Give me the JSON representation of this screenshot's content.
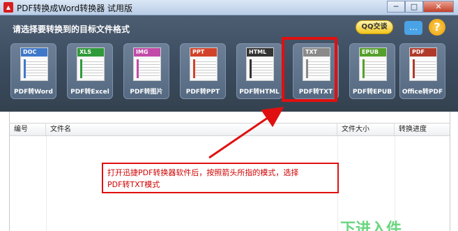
{
  "window": {
    "title": "PDF转换成Word转换器 试用版",
    "controls": {
      "minimize": "─",
      "maximize": "□",
      "close": "✕"
    }
  },
  "header": {
    "prompt": "请选择要转换到的目标文件格式",
    "qq_button": "QQ交谈",
    "tiles": [
      {
        "tag": "DOC",
        "label": "PDF转Word",
        "color": "#3f78c9",
        "icon": "word-doc-icon"
      },
      {
        "tag": "XLS",
        "label": "PDF转Excel",
        "color": "#2f9a3a",
        "icon": "excel-chart-icon"
      },
      {
        "tag": "IMG",
        "label": "PDF转图片",
        "color": "#c24aa8",
        "icon": "image-icon"
      },
      {
        "tag": "PPT",
        "label": "PDF转PPT",
        "color": "#d2422a",
        "icon": "ppt-chart-icon"
      },
      {
        "tag": "HTML",
        "label": "PDF转HTML",
        "color": "#333333",
        "icon": "globe-icon"
      },
      {
        "tag": "TXT",
        "label": "PDF转TXT",
        "color": "#8a8a8a",
        "icon": "text-doc-icon"
      },
      {
        "tag": "EPUB",
        "label": "PDF转EPUB",
        "color": "#55a02c",
        "icon": "epub-icon"
      },
      {
        "tag": "PDF",
        "label": "Office转PDF",
        "color": "#b03a2a",
        "icon": "acrobat-icon"
      }
    ]
  },
  "table": {
    "columns": [
      "编号",
      "文件名",
      "文件大小",
      "转换进度"
    ],
    "rows": []
  },
  "annotation": {
    "line1": "打开迅捷PDF转换器软件后，按照箭头所指的模式，选择",
    "line2": "PDF转TXT模式"
  },
  "watermark": "下进入件"
}
